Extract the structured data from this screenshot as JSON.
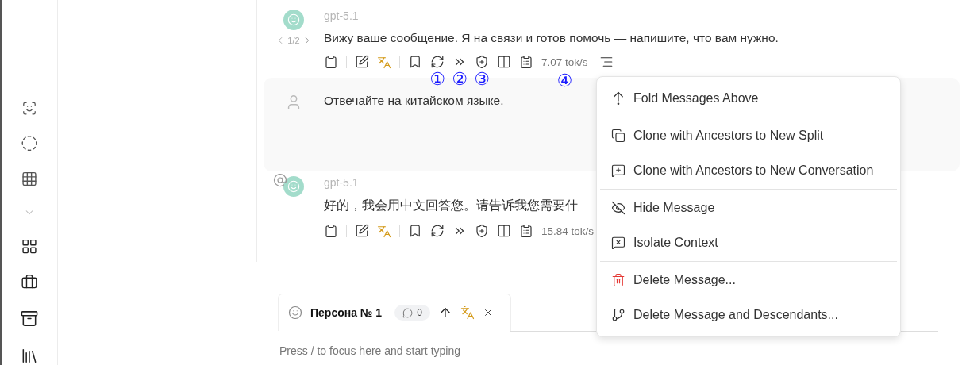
{
  "messages": [
    {
      "kind": "assistant",
      "model": "gpt-5.1",
      "text": "Вижу ваше сообщение. Я на связи и готов помочь — напишите, что вам нужно.",
      "pager": "1/2",
      "mentioned": false,
      "speed": "7.07 tok/s",
      "more_menu": true,
      "annotations": {
        "regenerate": "①",
        "continue": "②",
        "branch": "③",
        "speed": "④"
      }
    },
    {
      "kind": "user",
      "text": "Отвечайте на китайском языке."
    },
    {
      "kind": "assistant",
      "model": "gpt-5.1",
      "text": "好的，我会用中文回答您。请告诉我您需要什",
      "mentioned": true,
      "speed": "15.84 tok/s",
      "more_menu": false
    }
  ],
  "persona": {
    "name": "Персона № 1",
    "count": "0"
  },
  "composer": {
    "placeholder": "Press / to focus here and start typing"
  },
  "menu": {
    "groups": [
      [
        {
          "kind": "fold",
          "label": "Fold Messages Above"
        }
      ],
      [
        {
          "kind": "clone-split",
          "label": "Clone with Ancestors to New Split"
        },
        {
          "kind": "clone-conversation",
          "label": "Clone with Ancestors to New Conversation"
        }
      ],
      [
        {
          "kind": "hide",
          "label": "Hide Message"
        },
        {
          "kind": "isolate",
          "label": "Isolate Context"
        }
      ],
      [
        {
          "kind": "delete",
          "label": "Delete Message..."
        },
        {
          "kind": "delete-descendants",
          "label": "Delete Message and Descendants..."
        }
      ]
    ]
  }
}
